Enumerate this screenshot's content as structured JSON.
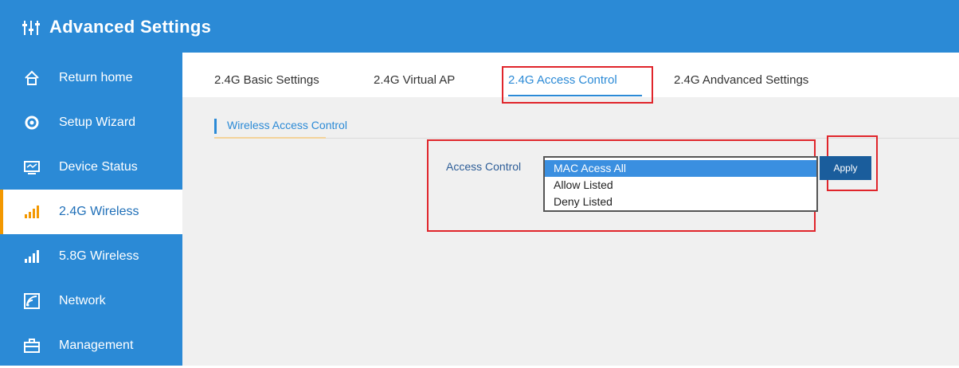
{
  "header": {
    "title": "Advanced Settings"
  },
  "sidebar": {
    "items": [
      {
        "label": "Return home",
        "icon": "home-icon"
      },
      {
        "label": "Setup Wizard",
        "icon": "gear-icon"
      },
      {
        "label": "Device Status",
        "icon": "monitor-icon"
      },
      {
        "label": "2.4G Wireless",
        "icon": "signal-bars-icon",
        "active": true
      },
      {
        "label": "5.8G Wireless",
        "icon": "signal-bars-icon"
      },
      {
        "label": "Network",
        "icon": "network-icon"
      },
      {
        "label": "Management",
        "icon": "toolbox-icon"
      }
    ]
  },
  "tabs": [
    {
      "label": "2.4G Basic Settings"
    },
    {
      "label": "2.4G Virtual AP"
    },
    {
      "label": "2.4G Access Control",
      "active": true
    },
    {
      "label": "2.4G Andvanced Settings"
    }
  ],
  "section": {
    "title": "Wireless Access Control"
  },
  "access_control": {
    "label": "Access Control",
    "options": [
      "MAC Acess All",
      "Allow Listed",
      "Deny Listed"
    ],
    "selected": "MAC Acess All"
  },
  "apply_label": "Apply",
  "colors": {
    "brand_blue": "#2b8ad6",
    "highlight_red": "#e0252b",
    "accent_orange": "#f39800"
  }
}
